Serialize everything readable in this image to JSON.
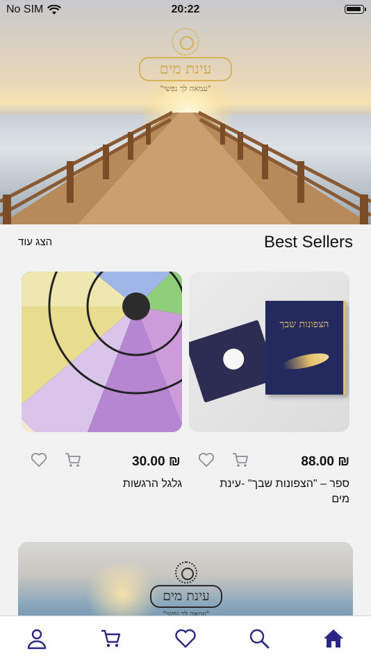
{
  "status_bar": {
    "carrier": "No SIM",
    "time": "20:22"
  },
  "hero": {
    "logo_title": "עינת מים",
    "logo_tagline": "\"עמאה לך נפשי\""
  },
  "section": {
    "title": "Best Sellers",
    "show_more": "הצג עוד"
  },
  "products": [
    {
      "price": "₪ 88.00",
      "name": "ספר – \"הצפונות שבך\" -עינת מים",
      "book_title": "הצפונות שבך"
    },
    {
      "price": "₪ 30.00",
      "name": "גלגל הרגשות"
    }
  ],
  "banner": {
    "logo_title": "עינת מים",
    "logo_tagline": "\"עמאה לך נפשי\""
  },
  "colors": {
    "accent": "#2b2583",
    "icon_gray": "#8e8e93"
  },
  "icons": {
    "wishlist": "heart-outline-icon",
    "add_to_cart": "cart-outline-icon",
    "tabs": [
      "user-icon",
      "cart-icon",
      "heart-icon",
      "search-icon",
      "home-icon"
    ]
  }
}
